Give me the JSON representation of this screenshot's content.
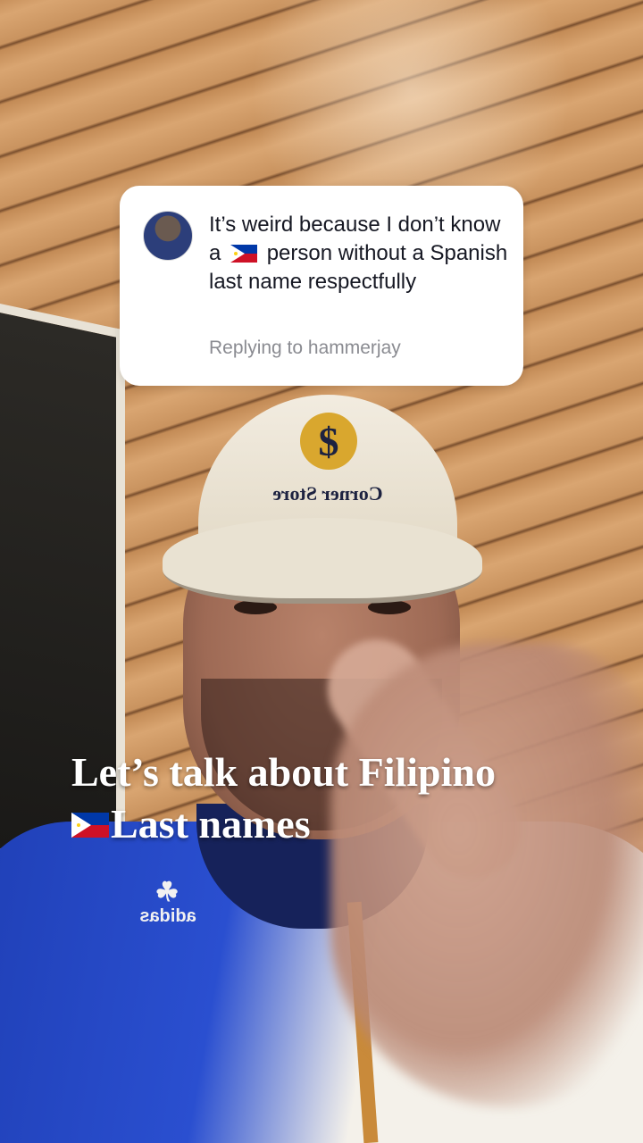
{
  "reply_card": {
    "comment_part1": "It’s weird because I don’t know a",
    "flag_emoji": "philippines-flag",
    "comment_part2": "person without a Spanish last name respectfully",
    "replying_to": "Replying to hammerjay"
  },
  "caption": {
    "line1": "Let’s talk about Filipino",
    "flag_emoji": "philippines-flag",
    "line2": "Last names"
  },
  "scene": {
    "cap_text": "Corner Store",
    "cap_logo": "$",
    "shirt_brand": "adidas"
  },
  "colors": {
    "card_bg": "#ffffff",
    "text_primary": "#161823",
    "text_secondary": "#8a8b91",
    "flag_blue": "#0038a8",
    "flag_red": "#ce1126",
    "flag_yellow": "#fcd116"
  }
}
